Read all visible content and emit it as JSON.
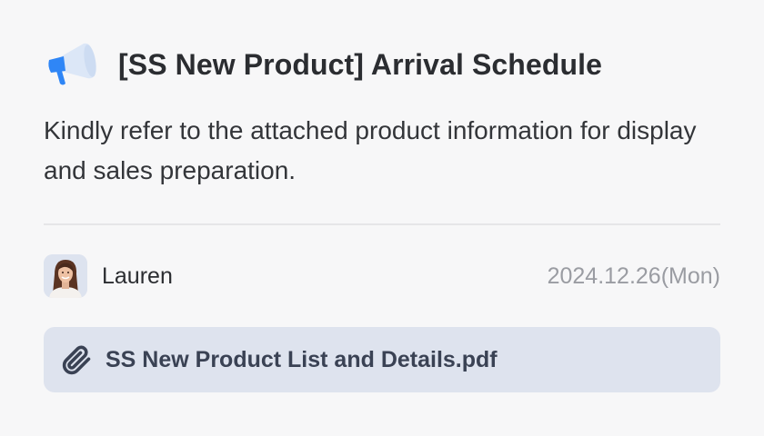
{
  "post": {
    "title": "[SS New Product] Arrival Schedule",
    "body": "Kindly refer to the attached product information for display and sales preparation.",
    "author": "Lauren",
    "date": "2024.12.26(Mon)",
    "attachment": {
      "filename": "SS New Product List and Details.pdf",
      "icon": "paperclip-icon"
    },
    "title_icon": "megaphone-icon"
  },
  "colors": {
    "background": "#f7f7f8",
    "attachment_bg": "#dee3ee",
    "megaphone_blue": "#2f86f6",
    "megaphone_light": "#dce7f7",
    "text_primary": "#2b2d31",
    "text_muted": "#9a9ca2"
  }
}
